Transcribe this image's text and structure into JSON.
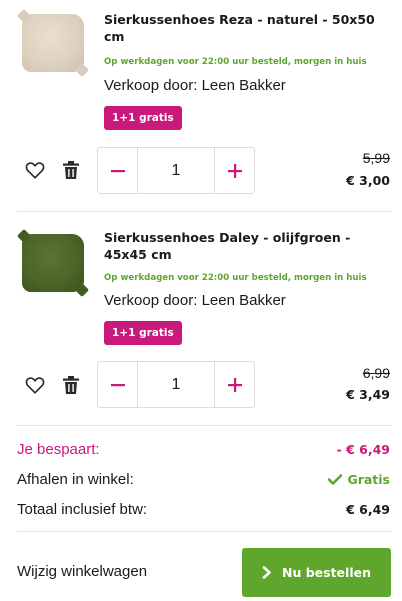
{
  "items": [
    {
      "title": "Sierkussenhoes Reza - naturel - 50x50 cm",
      "delivery": "Op werkdagen voor 22:00 uur besteld, morgen in huis",
      "seller": "Verkoop door: Leen Bakker",
      "badge": "1+1 gratis",
      "quantity": "1",
      "old_price": "5,99",
      "new_price": "€ 3,00",
      "image_color": "#ddd1c1"
    },
    {
      "title": "Sierkussenhoes Daley - olijfgroen - 45x45 cm",
      "delivery": "Op werkdagen voor 22:00 uur besteld, morgen in huis",
      "seller": "Verkoop door: Leen Bakker",
      "badge": "1+1 gratis",
      "quantity": "1",
      "old_price": "6,99",
      "new_price": "€ 3,49",
      "image_color": "#4c6528"
    }
  ],
  "summary": {
    "savings_label": "Je bespaart:",
    "savings_value": "- € 6,49",
    "pickup_label": "Afhalen in winkel:",
    "pickup_value": "Gratis",
    "total_label": "Totaal inclusief btw:",
    "total_value": "€ 6,49"
  },
  "footer": {
    "edit_cart": "Wijzig winkelwagen",
    "order_button": "Nu bestellen"
  },
  "icons": {
    "wishlist": "heart-icon",
    "delete": "trash-icon",
    "decrease": "minus-icon",
    "increase": "plus-icon",
    "check": "checkmark-icon",
    "proceed": "chevron-right-icon"
  },
  "colors": {
    "accent_pink": "#c9197d",
    "accent_green": "#5ea62c"
  }
}
